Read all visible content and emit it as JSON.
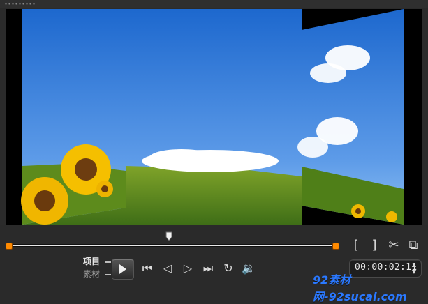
{
  "modes": {
    "project": "项目",
    "clip": "素材"
  },
  "player": {
    "timecode": "00:00:02:11"
  },
  "watermark": "92素材网-92sucai.com",
  "icons": {
    "mark_in": "mark-in-icon",
    "mark_out": "mark-out-icon",
    "split": "scissors-icon",
    "enlarge": "enlarge-preview-icon",
    "play": "play-icon",
    "home": "home-icon",
    "previous_frame": "previous-frame-icon",
    "next_frame": "next-frame-icon",
    "end": "end-icon",
    "repeat": "repeat-icon",
    "volume": "volume-icon"
  },
  "colors": {
    "trim_handle": "#ff8a00",
    "watermark": "#2b79ff"
  },
  "timeline": {
    "playhead_position_percent": 49
  }
}
